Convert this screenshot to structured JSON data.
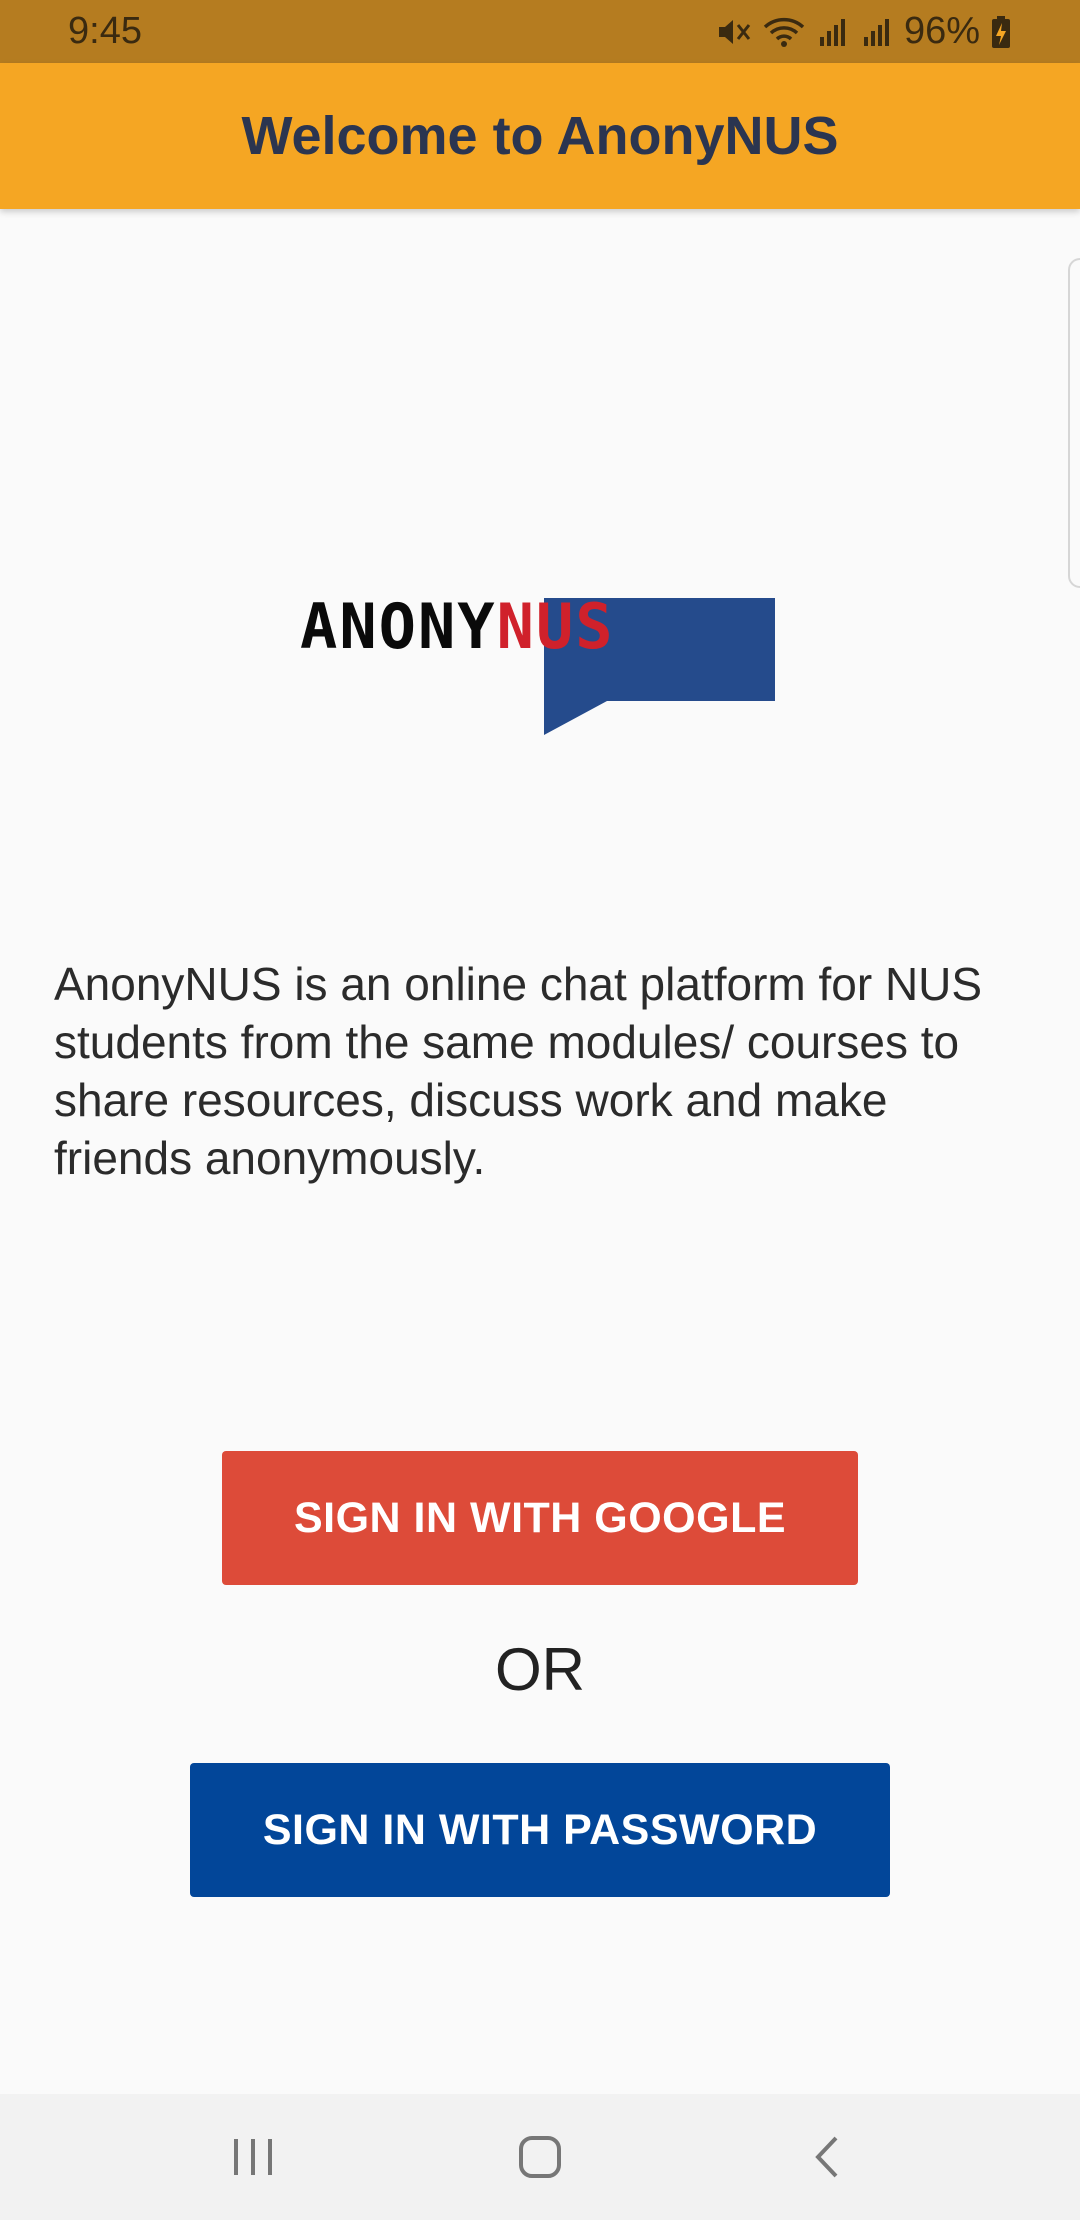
{
  "status_bar": {
    "time": "9:45",
    "battery": "96%",
    "icons": [
      "mute-icon",
      "wifi-icon",
      "signal-icon",
      "signal-icon",
      "battery-charging-icon"
    ]
  },
  "app_bar": {
    "title": "Welcome to AnonyNUS"
  },
  "logo": {
    "part1": "ANONY",
    "part2": "NUS",
    "colors": {
      "text": "#0a0a0a",
      "accent": "#d0212b",
      "bubble": "#254b8c"
    }
  },
  "description": "AnonyNUS is an online chat platform for NUS students from the same modules/ courses to share resources, discuss work and make friends anonymously.",
  "buttons": {
    "google_label": "SIGN IN WITH GOOGLE",
    "or_label": "OR",
    "password_label": "SIGN IN WITH PASSWORD"
  },
  "colors": {
    "status_bar": "#b57c20",
    "app_bar": "#f5a623",
    "google_button": "#dd4b39",
    "password_button": "#024699"
  },
  "nav_bar": {
    "icons": [
      "recents-icon",
      "home-icon",
      "back-icon"
    ]
  }
}
